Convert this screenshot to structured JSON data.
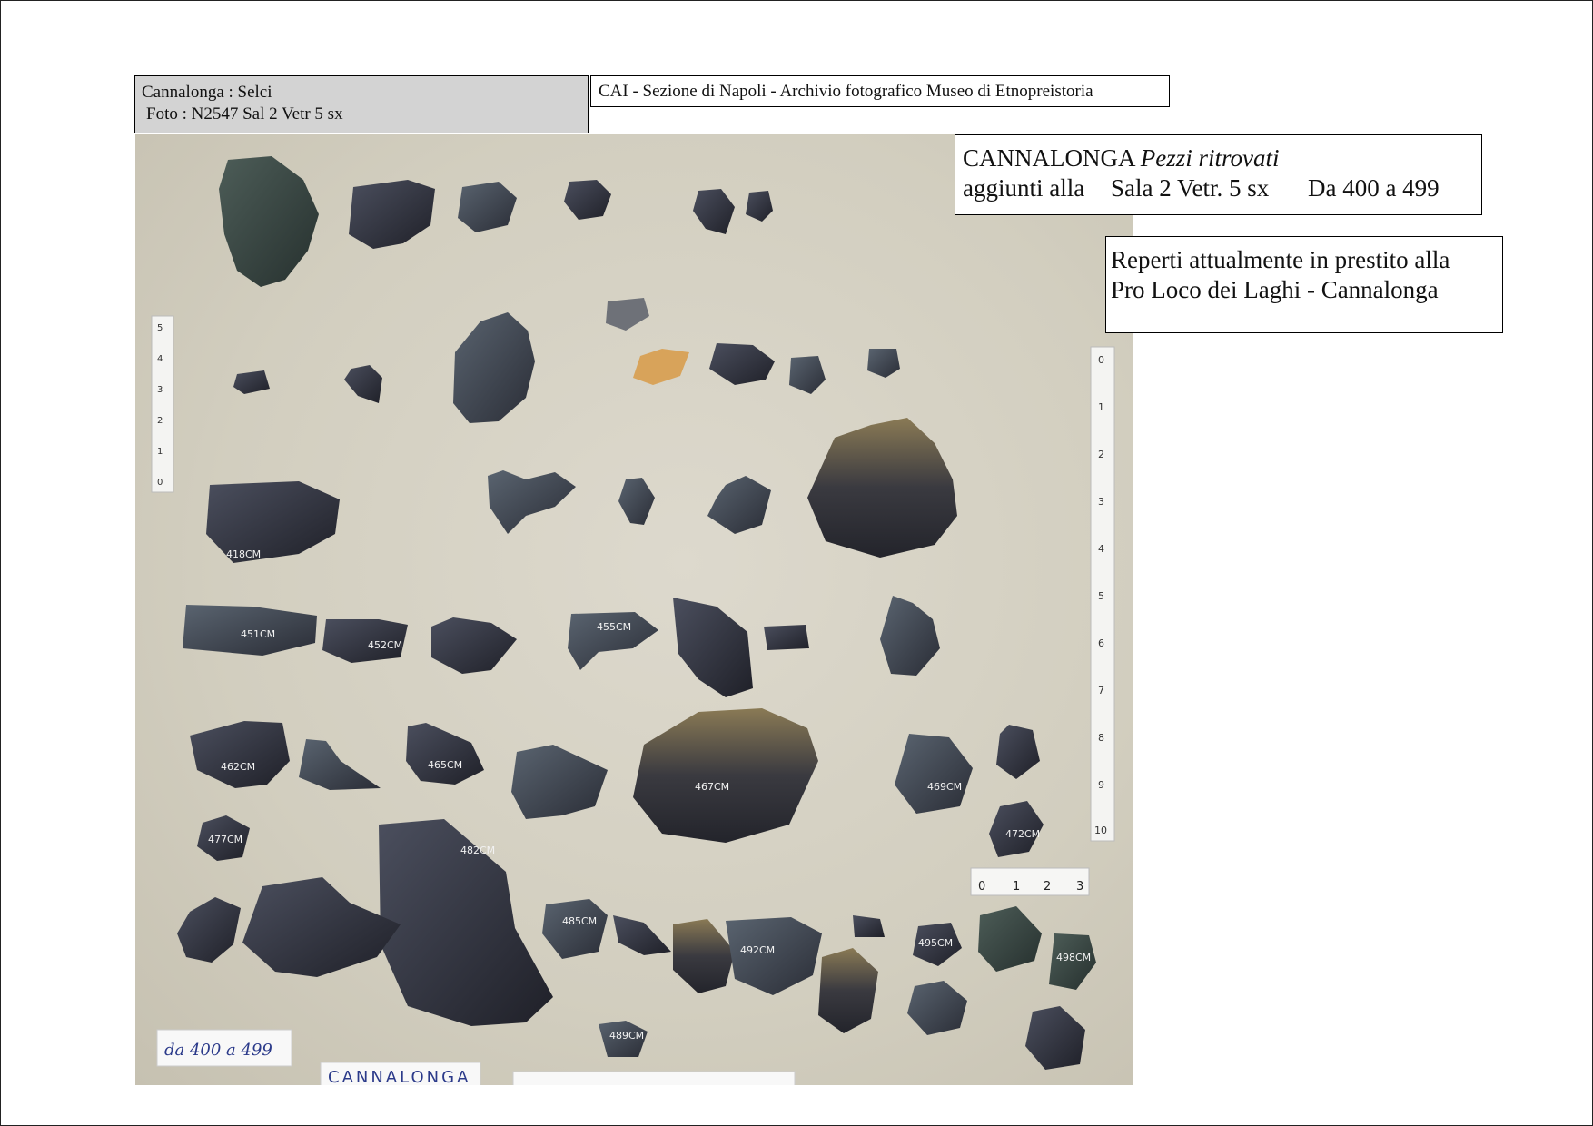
{
  "header": {
    "title_line1": "Cannalonga  :  Selci",
    "title_line2": "Foto : N2547   Sal 2 Vetr 5 sx",
    "archive": "CAI - Sezione di Napoli  - Archivio fotografico Museo di Etnopreistoria"
  },
  "info_box": {
    "line1_bold": "CANNALONGA",
    "line1_rest": "Pezzi ritrovati",
    "line2_a": "aggiunti alla",
    "line2_b": "Sala 2  Vetr. 5 sx",
    "line2_c": "Da 400 a 499"
  },
  "loan_box": {
    "line1": "Reperti attualmente in prestito alla",
    "line2": "Pro Loco dei Laghi - Cannalonga"
  },
  "photo": {
    "handwritten_range": "da 400 a 499",
    "bottom_card": "CANNALONGA",
    "ruler_small": [
      "0",
      "1",
      "2",
      "3"
    ],
    "ruler_left": [
      "0",
      "1",
      "2",
      "3",
      "4",
      "5"
    ],
    "ruler_right": [
      "0",
      "1",
      "2",
      "3",
      "4",
      "5",
      "6",
      "7",
      "8",
      "9",
      "10"
    ],
    "specimen_labels": [
      "418CM",
      "451CM",
      "452CM",
      "455CM",
      "462CM",
      "465CM",
      "467CM",
      "469CM",
      "472CM",
      "477CM",
      "482CM",
      "485CM",
      "489CM",
      "492CM",
      "495CM",
      "498CM"
    ]
  }
}
